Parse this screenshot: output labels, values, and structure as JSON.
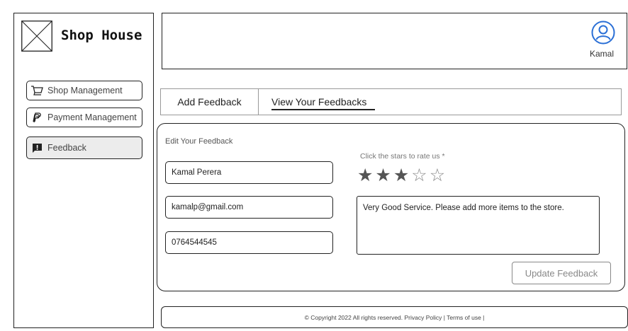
{
  "brand": {
    "name": "Shop House"
  },
  "sidebar": {
    "items": [
      {
        "label": "Shop Management",
        "icon": "cart-icon"
      },
      {
        "label": "Payment Management",
        "icon": "paypal-icon"
      },
      {
        "label": "Feedback",
        "icon": "feedback-icon",
        "active": true
      }
    ]
  },
  "header": {
    "user_name": "Kamal",
    "user_icon": "user-icon"
  },
  "tabs": [
    {
      "label": "Add Feedback"
    },
    {
      "label": "View Your Feedbacks",
      "active": true
    }
  ],
  "form": {
    "title": "Edit Your Feedback",
    "name_value": "Kamal Perera",
    "email_value": "kamalp@gmail.com",
    "phone_value": "0764544545",
    "rating_label": "Click the stars to rate us *",
    "rating": 3,
    "rating_max": 5,
    "comment_value": "Very Good Service. Please add more items to the store.",
    "update_label": "Update Feedback"
  },
  "footer": {
    "text": "© Copyright 2022 All rights reserved. Privacy Policy | Terms of use |"
  }
}
